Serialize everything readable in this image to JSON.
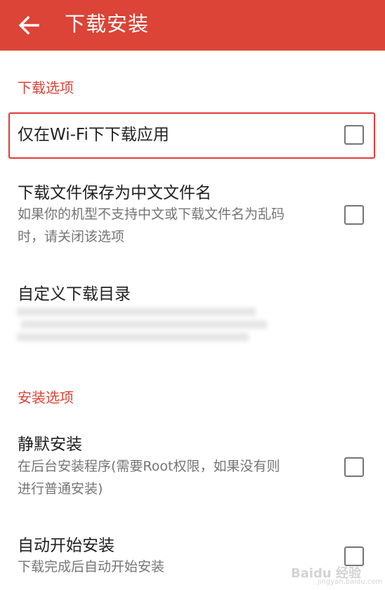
{
  "app_bar": {
    "back_icon": "arrow-left-icon",
    "title": "下载安装",
    "color": "#db4437"
  },
  "sections": {
    "download": {
      "header": "下载选项",
      "wifi_only": {
        "title": "仅在Wi-Fi下下载应用",
        "checked": false
      },
      "chinese_filename": {
        "title": "下载文件保存为中文文件名",
        "summary_line1": "如果你的机型不支持中文或下载文件名为乱码",
        "summary_line2": "时，请关闭该选项",
        "checked": false
      },
      "custom_dir": {
        "title": "自定义下载目录",
        "summary": ""
      }
    },
    "install": {
      "header": "安装选项",
      "silent_install": {
        "title": "静默安装",
        "summary_line1": "在后台安装程序(需要Root权限，如果没有则",
        "summary_line2": "进行普通安装)",
        "checked": false
      },
      "auto_install": {
        "title": "自动开始安装",
        "summary": "下载完成后自动开始安装",
        "checked": false
      }
    }
  },
  "colors": {
    "accent": "#db4437",
    "highlight_border": "#e53935",
    "secondary_text": "#757575"
  },
  "watermark": {
    "main": "Baidu 经验",
    "sub": "jingyan.baidu.com"
  }
}
